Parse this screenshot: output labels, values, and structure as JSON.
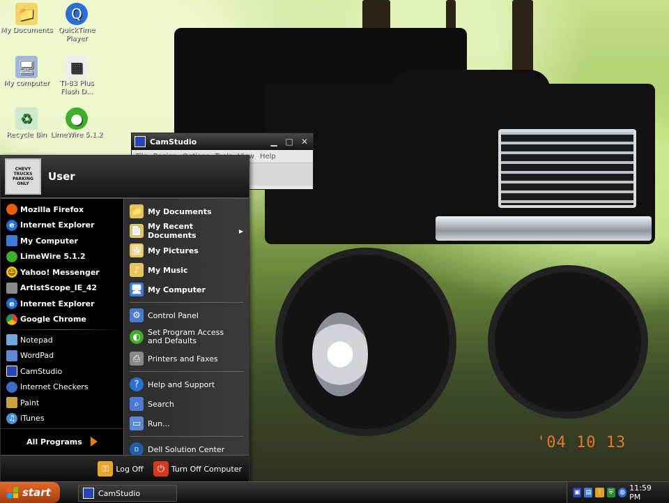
{
  "desktop": {
    "icons": [
      {
        "label": "My Documents",
        "icon": "folder-icon"
      },
      {
        "label": "QuickTime Player",
        "icon": "quicktime-icon"
      },
      {
        "label": "My computer",
        "icon": "computer-icon"
      },
      {
        "label": "TI-83 Plus Flash D...",
        "icon": "calculator-shortcut-icon"
      },
      {
        "label": "Recycle Bin",
        "icon": "recycle-bin-icon"
      },
      {
        "label": "LimeWire 5.1.2",
        "icon": "limewire-icon"
      }
    ],
    "date_stamp": "'04 10 13"
  },
  "camstudio_window": {
    "title": "CamStudio",
    "menu": [
      "File",
      "Region",
      "Options",
      "Tools",
      "View",
      "Help"
    ]
  },
  "start_menu": {
    "user_name": "User",
    "avatar_text": "CHEVY TRUCKS PARKING ONLY",
    "pinned": [
      {
        "label": "Mozilla Firefox",
        "icon": "firefox-icon",
        "color": "#e66000"
      },
      {
        "label": "Internet Explorer",
        "icon": "internet-explorer-icon",
        "color": "#1e6fd9"
      }
    ],
    "recent_top": [
      {
        "label": "My Computer",
        "icon": "computer-icon",
        "color": "#3a7bd5"
      },
      {
        "label": "LimeWire 5.1.2",
        "icon": "limewire-icon",
        "color": "#3fae2a"
      },
      {
        "label": "Yahoo! Messenger",
        "icon": "yahoo-messenger-icon",
        "color": "#f5c400"
      },
      {
        "label": "ArtistScope_IE_42",
        "icon": "window-icon",
        "color": "#8a8a8a"
      },
      {
        "label": "Internet Explorer",
        "icon": "internet-explorer-icon",
        "color": "#1e6fd9"
      },
      {
        "label": "Google Chrome",
        "icon": "chrome-icon",
        "color": "#db4437"
      }
    ],
    "recent": [
      {
        "label": "Notepad",
        "icon": "notepad-icon",
        "color": "#6fa8dc"
      },
      {
        "label": "WordPad",
        "icon": "wordpad-icon",
        "color": "#5b8bd6"
      },
      {
        "label": "CamStudio",
        "icon": "camstudio-icon",
        "color": "#2846b8"
      },
      {
        "label": "Internet Checkers",
        "icon": "checkers-icon",
        "color": "#3c6cc9"
      },
      {
        "label": "Paint",
        "icon": "paint-icon",
        "color": "#c9a23c"
      },
      {
        "label": "iTunes",
        "icon": "itunes-icon",
        "color": "#4a8fd4"
      }
    ],
    "all_programs": "All Programs",
    "places": [
      {
        "label": "My Documents",
        "icon": "folder-icon",
        "color": "#e8c45a"
      },
      {
        "label": "My Recent Documents",
        "icon": "recent-documents-icon",
        "color": "#e8c45a",
        "submenu": true
      },
      {
        "label": "My Pictures",
        "icon": "pictures-icon",
        "color": "#e8c45a"
      },
      {
        "label": "My Music",
        "icon": "music-icon",
        "color": "#e8c45a"
      },
      {
        "label": "My Computer",
        "icon": "computer-icon",
        "color": "#3a7bd5"
      }
    ],
    "settings": [
      {
        "label": "Control Panel",
        "icon": "control-panel-icon",
        "color": "#4a7bd5"
      },
      {
        "label": "Set Program Access and Defaults",
        "icon": "program-access-icon",
        "color": "#3fae2a"
      },
      {
        "label": "Printers and Faxes",
        "icon": "printer-icon",
        "color": "#888888"
      }
    ],
    "help": [
      {
        "label": "Help and Support",
        "icon": "help-icon",
        "color": "#2a6fd6"
      },
      {
        "label": "Search",
        "icon": "search-icon",
        "color": "#4a7bd5"
      },
      {
        "label": "Run...",
        "icon": "run-icon",
        "color": "#5a8ad6"
      }
    ],
    "dell": {
      "label": "Dell Solution Center",
      "icon": "dell-icon",
      "color": "#1d5fa8"
    },
    "log_off": "Log Off",
    "turn_off": "Turn Off Computer"
  },
  "taskbar": {
    "start_label": "start",
    "task_label": "CamStudio",
    "clock": "11:59 PM"
  }
}
